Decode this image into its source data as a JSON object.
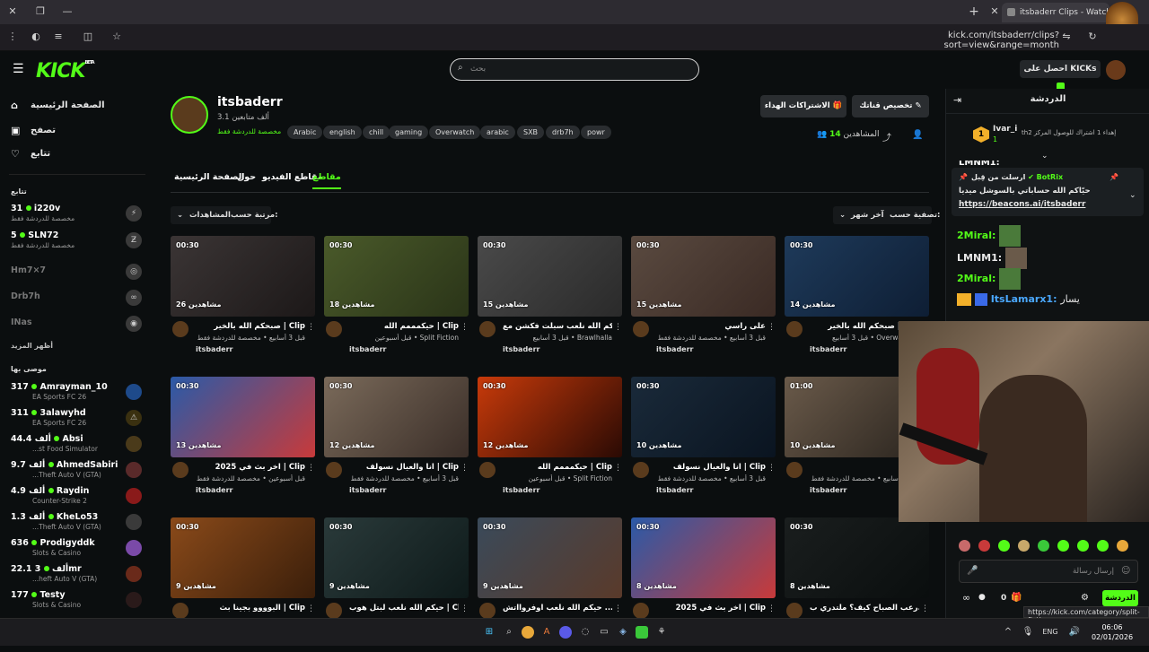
{
  "browser": {
    "tab_title": "itsbaderr Clips - Watch Live",
    "url": "kick.com/itsbaderr/clips?sort=view&range=month",
    "status_url": "https://kick.com/category/split-fiction"
  },
  "topnav": {
    "logo": "KICK",
    "logo_badge": "BETA",
    "search_placeholder": "بحث",
    "get_kicks": "احصل على KICKs"
  },
  "sidebar": {
    "nav": [
      {
        "label": "الصفحة الرئيسية",
        "icon": "home-icon"
      },
      {
        "label": "تصفح",
        "icon": "browse-icon"
      },
      {
        "label": "تتابع",
        "icon": "heart-icon"
      }
    ],
    "following_title": "تتابع",
    "following": [
      {
        "name": "i220v",
        "count": "31",
        "sub": "مخصصة للدردشة فقط",
        "online": true
      },
      {
        "name": "SLN72",
        "count": "5",
        "sub": "مخصصة للدردشة فقط",
        "online": true
      },
      {
        "name": "Hm7×7",
        "count": "",
        "sub": "",
        "online": false
      },
      {
        "name": "Drb7h",
        "count": "",
        "sub": "",
        "online": false
      },
      {
        "name": "INas",
        "count": "",
        "sub": "",
        "online": false
      }
    ],
    "show_more": "أظهر المزيد",
    "recommended_title": "موصى بها",
    "recommended": [
      {
        "name": "Amrayman_10",
        "count": "317",
        "game": "EA Sports FC 26"
      },
      {
        "name": "3alawyhd",
        "count": "311",
        "game": "EA Sports FC 26"
      },
      {
        "name": "Absi",
        "count": "44.4 ألف",
        "game": "...st Food Simulator"
      },
      {
        "name": "AhmedSabiri",
        "count": "9.7 ألف",
        "game": "...Theft Auto V (GTA)"
      },
      {
        "name": "Raydin",
        "count": "4.9 ألف",
        "game": "Counter-Strike 2"
      },
      {
        "name": "KheLo53",
        "count": "1.3 ألف",
        "game": "...Theft Auto V (GTA)"
      },
      {
        "name": "Prodigyddk",
        "count": "636",
        "game": "Slots & Casino"
      },
      {
        "name": "3mr",
        "count": "22.1 ألف",
        "game": "...heft Auto V (GTA)"
      },
      {
        "name": "Testy",
        "count": "177",
        "game": "Slots & Casino"
      }
    ]
  },
  "channel": {
    "name": "itsbaderr",
    "followers": "3.1 ألف متابعين",
    "subtitle": "مخصصة للدردشة فقط",
    "live_badge": "LIVE",
    "tags": [
      "Arabic",
      "english",
      "chill",
      "gaming",
      "Overwatch",
      "arabic",
      "SXB",
      "drb7h",
      "powr"
    ],
    "customize_button": "تخصيص قناتك",
    "gift_button": "الاشتراكات الهداء",
    "viewers_label": "المشاهدين",
    "viewers_count": "14"
  },
  "tabs": [
    "الصفحة الرئيسية",
    "حول",
    "مقاطع الفيديو",
    "مقاطع"
  ],
  "filters": {
    "filter_label": "تصفية حسب:",
    "filter_value": "آخر شهر",
    "sort_label": "مرتبة حسب:",
    "sort_value": "المشاهدات"
  },
  "clips": [
    {
      "duration": "00:30",
      "views": "26 مشاهدين",
      "title": "صبحكم الله بالخير | Clip",
      "meta": "قبل 3 أسابيع • مخصصة للدردشة فقط",
      "channel": "itsbaderr",
      "c1": "#3b3535",
      "c2": "#1c1818"
    },
    {
      "duration": "00:30",
      "views": "18 مشاهدين",
      "title": "حيكمممم الله | Clip",
      "meta": "قبل أسبوعين • Split Fiction",
      "channel": "itsbaderr",
      "c1": "#4a5a2a",
      "c2": "#2a3418"
    },
    {
      "duration": "00:30",
      "views": "15 مشاهدين",
      "title": "حيكم الله نلعب سبلت فكشن مع...",
      "meta": "قبل 3 أسابيع • Brawlhalla",
      "channel": "itsbaderr",
      "c1": "#4a4a4a",
      "c2": "#2a2a2a"
    },
    {
      "duration": "00:30",
      "views": "15 مشاهدين",
      "title": "على راسي",
      "meta": "قبل 3 أسابيع • مخصصة للدردشة فقط",
      "channel": "itsbaderr",
      "c1": "#5a4a40",
      "c2": "#3a2a24"
    },
    {
      "duration": "00:30",
      "views": "14 مشاهدين",
      "title": "صبحكم الله بالخير | Clip",
      "meta": "قبل 3 أسابيع • Overwatch 2",
      "channel": "itsbaderr",
      "c1": "#1e3a5a",
      "c2": "#0e1e34"
    },
    {
      "duration": "00:30",
      "views": "13 مشاهدين",
      "title": "اخر بث في 2025 | Clip",
      "meta": "قبل أسبوعين • مخصصة للدردشة فقط",
      "channel": "itsbaderr",
      "c1": "#2a5aa8",
      "c2": "#c83a3a"
    },
    {
      "duration": "00:30",
      "views": "12 مشاهدين",
      "title": "انا والعيال نسولف | Clip",
      "meta": "قبل 3 أسابيع • مخصصة للدردشة فقط",
      "channel": "itsbaderr",
      "c1": "#7a6a5a",
      "c2": "#3a2e28"
    },
    {
      "duration": "00:30",
      "views": "12 مشاهدين",
      "title": "حيكمممم الله | Clip",
      "meta": "قبل أسبوعين • Split Fiction",
      "channel": "itsbaderr",
      "c1": "#c83a0a",
      "c2": "#2a0a04"
    },
    {
      "duration": "00:30",
      "views": "10 مشاهدين",
      "title": "انا والعيال نسولف | Clip",
      "meta": "قبل 3 أسابيع • مخصصة للدردشة فقط",
      "channel": "itsbaderr",
      "c1": "#1a2a3a",
      "c2": "#0a1420"
    },
    {
      "duration": "01:00",
      "views": "10 مشاهدين",
      "title": "\"•",
      "meta": "قبل 3 أسابيع • مخصصة للدردشة فقط",
      "channel": "itsbaderr",
      "c1": "#6a5a4a",
      "c2": "#2a241e"
    },
    {
      "duration": "00:30",
      "views": "9 مشاهدين",
      "title": "البوووو بجينا بث | Clip",
      "meta": "",
      "channel": "",
      "c1": "#8a4a1a",
      "c2": "#3a1e0a"
    },
    {
      "duration": "00:30",
      "views": "9 مشاهدين",
      "title": "حيكم الله نلعب لبتل هوب | Clip",
      "meta": "",
      "channel": "",
      "c1": "#2a3a3a",
      "c2": "#0e1a1a"
    },
    {
      "duration": "00:30",
      "views": "9 مشاهدين",
      "title": "حيكم الله نلعب اوفروااتش ...",
      "meta": "",
      "channel": "",
      "c1": "#3a4a5a",
      "c2": "#5a3a2a"
    },
    {
      "duration": "00:30",
      "views": "8 مشاهدين",
      "title": "اخر بث في 2025 | Clip",
      "meta": "",
      "channel": "",
      "c1": "#2a5aa8",
      "c2": "#c83a3a"
    },
    {
      "duration": "00:30",
      "views": "8 مشاهدين",
      "title": "رعب الصباح كيف؟ ملتدري ب...",
      "meta": "",
      "channel": "",
      "c1": "#1a1e1e",
      "c2": "#0a0e0e"
    }
  ],
  "chat": {
    "title": "الدردشة",
    "top_gifter_name": "Ivar_i",
    "top_gifter_count": "1",
    "gift_info": "إهداء 1 اشتراك للوصول المركز 2",
    "gift_info_end": "th",
    "pinned_by": "ارسلت من قِبل",
    "pinned_user": "BotRix",
    "pinned_text": "حيّاكم الله حساباتي بالسوشل ميديا",
    "pinned_link": "https://beacons.ai/itsbaderr",
    "messages": [
      {
        "user": "2Miral:",
        "color": "#53fc18"
      },
      {
        "user": "LMNM1:",
        "color": "#ffffff"
      },
      {
        "user": "2Miral:",
        "color": "#53fc18"
      },
      {
        "user": "ItsLamarx1:",
        "color": "#4aa8ff",
        "text": "يسار"
      }
    ],
    "input_placeholder": "إرسال رسالة",
    "send_button": "الدردشة",
    "kicks_count": "0"
  },
  "taskbar": {
    "lang": "ENG",
    "time": "06:06",
    "date": "02/01/2026"
  }
}
